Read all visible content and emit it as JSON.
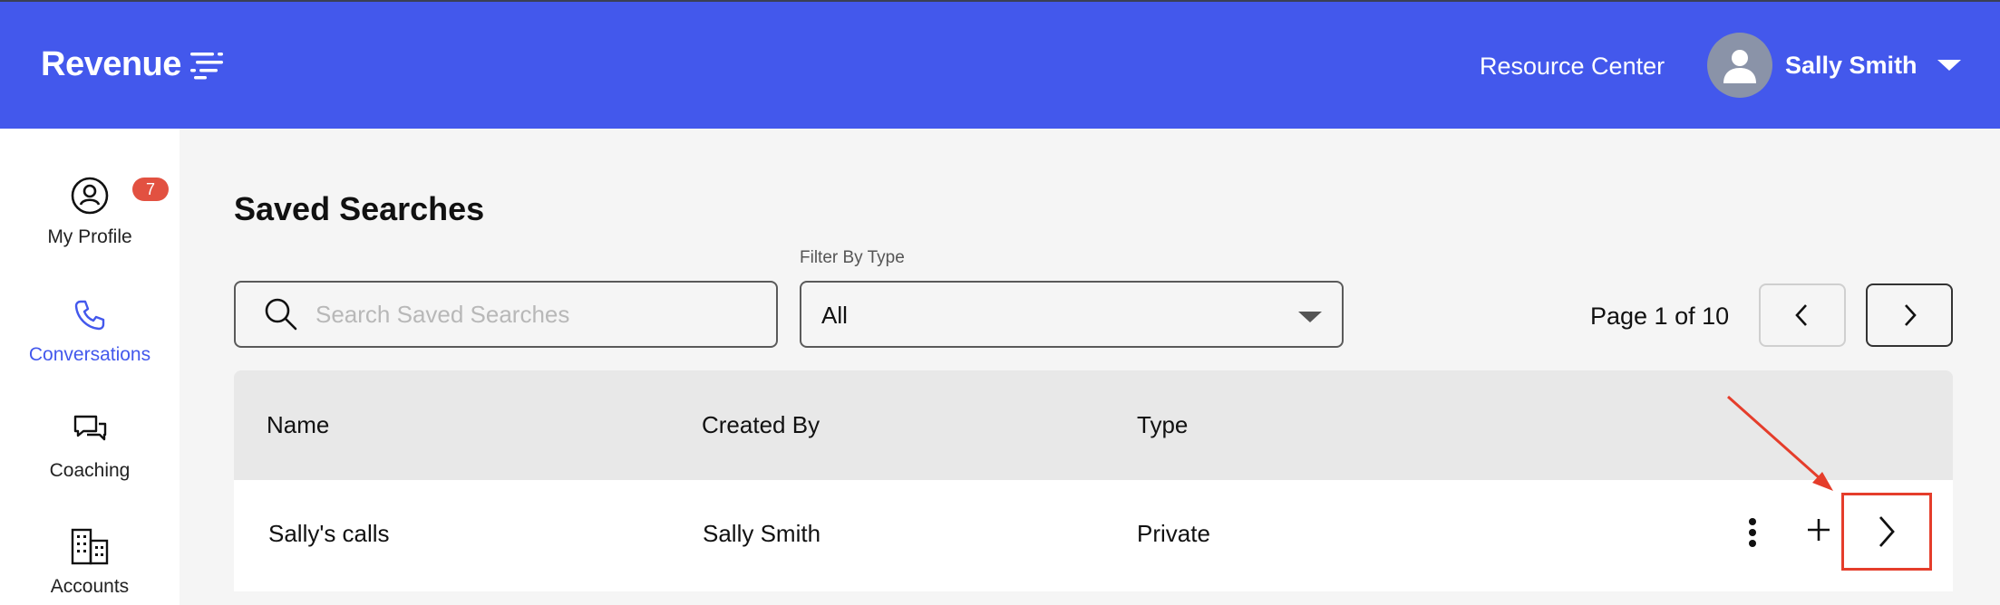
{
  "header": {
    "logo_text": "Revenue",
    "resource_center": "Resource Center",
    "user_name": "Sally Smith"
  },
  "sidebar": {
    "items": [
      {
        "label": "My Profile",
        "icon": "user-circle-icon",
        "badge": "7",
        "active": false
      },
      {
        "label": "Conversations",
        "icon": "phone-icon",
        "active": true
      },
      {
        "label": "Coaching",
        "icon": "chat-bubbles-icon",
        "active": false
      },
      {
        "label": "Accounts",
        "icon": "building-icon",
        "active": false
      }
    ]
  },
  "main": {
    "title": "Saved Searches",
    "search": {
      "placeholder": "Search Saved Searches",
      "value": ""
    },
    "filter": {
      "label": "Filter By Type",
      "value": "All"
    },
    "pagination": {
      "text": "Page 1 of 10"
    },
    "table": {
      "columns": [
        "Name",
        "Created By",
        "Type"
      ],
      "rows": [
        {
          "name": "Sally's calls",
          "created_by": "Sally Smith",
          "type": "Private"
        }
      ]
    }
  },
  "colors": {
    "brand": "#4358ec",
    "badge": "#e25141",
    "annotation": "#e53d2b"
  }
}
